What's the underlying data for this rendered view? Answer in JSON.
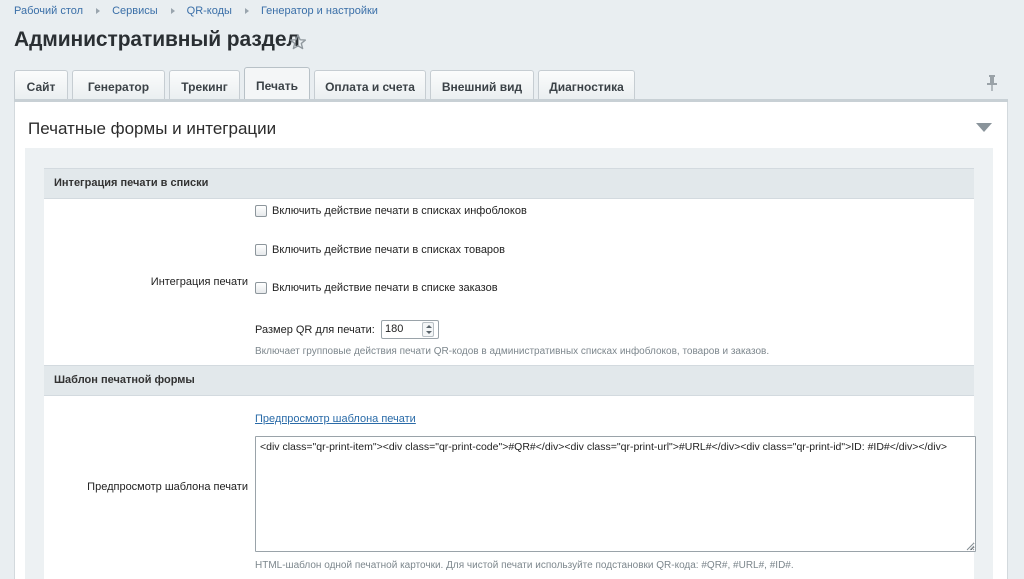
{
  "breadcrumb": [
    "Рабочий стол",
    "Сервисы",
    "QR-коды",
    "Генератор и настройки"
  ],
  "page_title": "Административный раздел",
  "tabs": [
    "Сайт",
    "Генератор",
    "Трекинг",
    "Печать",
    "Оплата и счета",
    "Внешний вид",
    "Диагностика"
  ],
  "active_tab": "Печать",
  "section_title": "Печатные формы и интеграции",
  "group1": {
    "heading": "Интеграция печати в списки",
    "label": "Интеграция печати",
    "checkboxes": [
      {
        "label": "Включить действие печати в списках инфоблоков",
        "checked": false
      },
      {
        "label": "Включить действие печати в списках товаров",
        "checked": false
      },
      {
        "label": "Включить действие печати в списке заказов",
        "checked": false
      }
    ],
    "qr_size_label": "Размер QR для печати:",
    "qr_size_value": "180",
    "hint": "Включает групповые действия печати QR-кодов в административных списках инфоблоков, товаров и заказов."
  },
  "group2": {
    "heading": "Шаблон печатной формы",
    "label": "Предпросмотр шаблона печати",
    "preview_link": "Предпросмотр шаблона печати",
    "template_value": "<div class=\"qr-print-item\"><div class=\"qr-print-code\">#QR#</div><div class=\"qr-print-url\">#URL#</div><div class=\"qr-print-id\">ID: #ID#</div></div>",
    "hint": "HTML-шаблон одной печатной карточки. Для чистой печати используйте подстановки QR-кода: #QR#, #URL#, #ID#."
  },
  "icons": {
    "favorite": "star-icon",
    "pin": "pin-icon",
    "collapse": "collapse-triangle-icon"
  },
  "colors": {
    "link": "#2a6ba8",
    "background": "#e9eef1"
  }
}
